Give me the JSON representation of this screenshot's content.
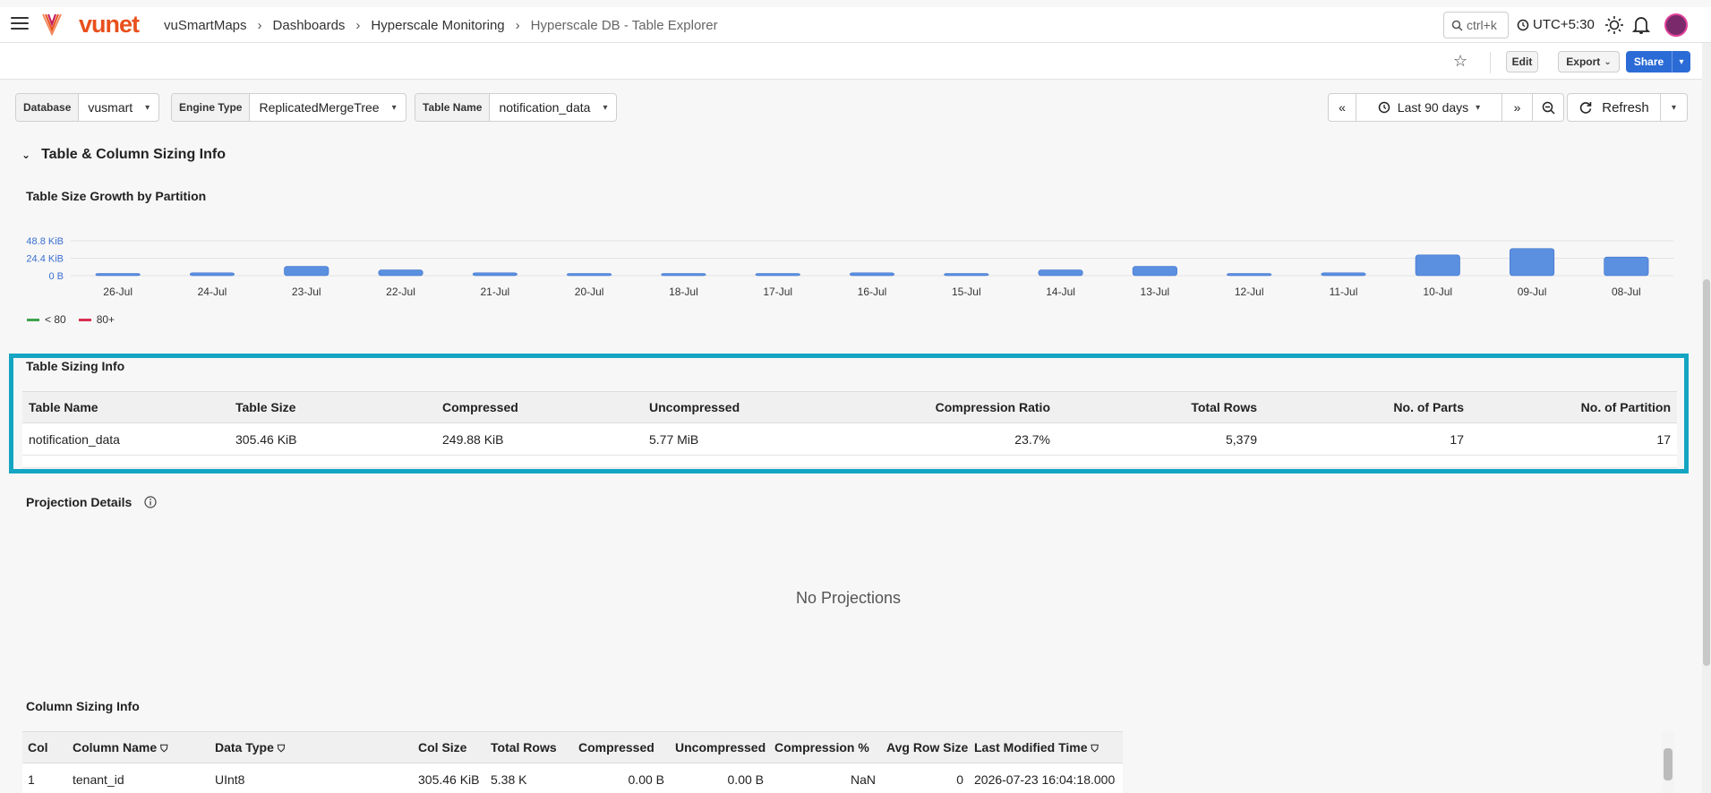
{
  "header": {
    "logo_text": "vunet",
    "breadcrumbs": [
      "vuSmartMaps",
      "Dashboards",
      "Hyperscale Monitoring",
      "Hyperscale DB - Table Explorer"
    ],
    "search_placeholder": "ctrl+k",
    "timezone": "UTC+5:30"
  },
  "toolbar": {
    "edit_label": "Edit",
    "export_label": "Export",
    "share_label": "Share"
  },
  "filters": [
    {
      "label": "Database",
      "value": "vusmart"
    },
    {
      "label": "Engine Type",
      "value": "ReplicatedMergeTree"
    },
    {
      "label": "Table Name",
      "value": "notification_data"
    }
  ],
  "time": {
    "range_label": "Last 90 days",
    "refresh_label": "Refresh"
  },
  "section": {
    "title": "Table & Column Sizing Info"
  },
  "growth_panel": {
    "title": "Table Size Growth by Partition"
  },
  "chart_data": {
    "type": "bar",
    "title": "Table Size Growth by Partition",
    "categories": [
      "26-Jul",
      "24-Jul",
      "23-Jul",
      "22-Jul",
      "21-Jul",
      "20-Jul",
      "18-Jul",
      "17-Jul",
      "16-Jul",
      "15-Jul",
      "14-Jul",
      "13-Jul",
      "12-Jul",
      "11-Jul",
      "10-Jul",
      "09-Jul",
      "08-Jul"
    ],
    "values": [
      3,
      4,
      13,
      8,
      4,
      3,
      3,
      3,
      4,
      3,
      8,
      13,
      3,
      4,
      29,
      38,
      26
    ],
    "value_unit": "KiB",
    "y_ticks": [
      "0 B",
      "24.4 KiB",
      "48.8 KiB"
    ],
    "ylim": [
      0,
      48.8
    ],
    "bar_color": "#5b8fe0",
    "grid": true,
    "legend": [
      {
        "label": "< 80",
        "color": "#3fa34d"
      },
      {
        "label": "80+",
        "color": "#d9304f"
      }
    ],
    "legend_position": "bottom-left"
  },
  "sizing_panel": {
    "title": "Table Sizing Info",
    "columns": [
      "Table Name",
      "Table Size",
      "Compressed",
      "Uncompressed",
      "Compression Ratio",
      "Total Rows",
      "No. of Parts",
      "No. of Partition"
    ],
    "rows": [
      [
        "notification_data",
        "305.46 KiB",
        "249.88 KiB",
        "5.77 MiB",
        "23.7%",
        "5,379",
        "17",
        "17"
      ]
    ]
  },
  "projection_panel": {
    "title": "Projection Details",
    "empty_text": "No Projections"
  },
  "column_panel": {
    "title": "Column Sizing Info",
    "columns": [
      "Col",
      "Column Name",
      "Data Type",
      "Col Size",
      "Total Rows",
      "Compressed",
      "Uncompressed",
      "Compression %",
      "Avg Row Size",
      "Last Modified Time"
    ],
    "rows": [
      [
        "1",
        "tenant_id",
        "UInt8",
        "305.46 KiB",
        "5.38 K",
        "0.00 B",
        "0.00 B",
        "NaN",
        "0",
        "2026-07-23 16:04:18.000"
      ]
    ]
  },
  "colors": {
    "accent": "#2b6bd6",
    "highlight": "#14a5c2",
    "brand": "#e8501c"
  }
}
